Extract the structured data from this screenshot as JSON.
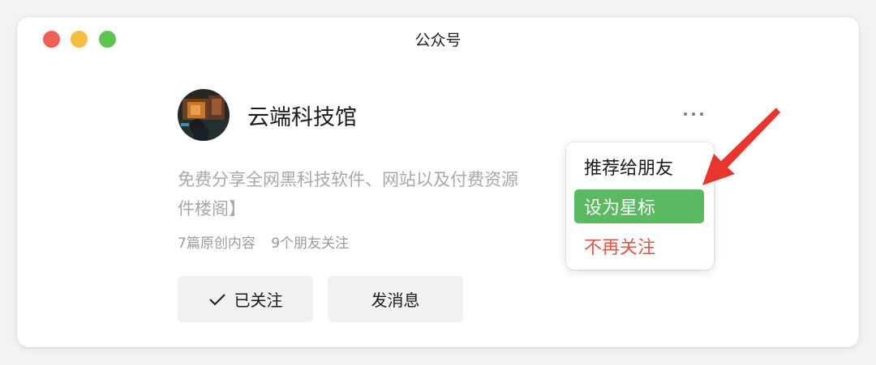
{
  "window": {
    "title": "公众号"
  },
  "account": {
    "name": "云端科技馆",
    "bio_line1": "免费分享全网黑科技软件、网站以及付费资源",
    "bio_line2": "件楼阁】",
    "articles": "7篇原创内容",
    "friends": "9个朋友关注"
  },
  "actions": {
    "following_label": "已关注",
    "message_label": "发消息"
  },
  "menu": {
    "items": [
      {
        "label": "推荐给朋友"
      },
      {
        "label": "设为星标"
      },
      {
        "label": "不再关注"
      }
    ]
  },
  "colors": {
    "highlight": "#5bb961",
    "danger": "#df5549",
    "annotation_arrow": "#e8362f"
  },
  "icons": {
    "more": "more-icon",
    "check": "check-icon",
    "avatar": "avatar-image"
  }
}
